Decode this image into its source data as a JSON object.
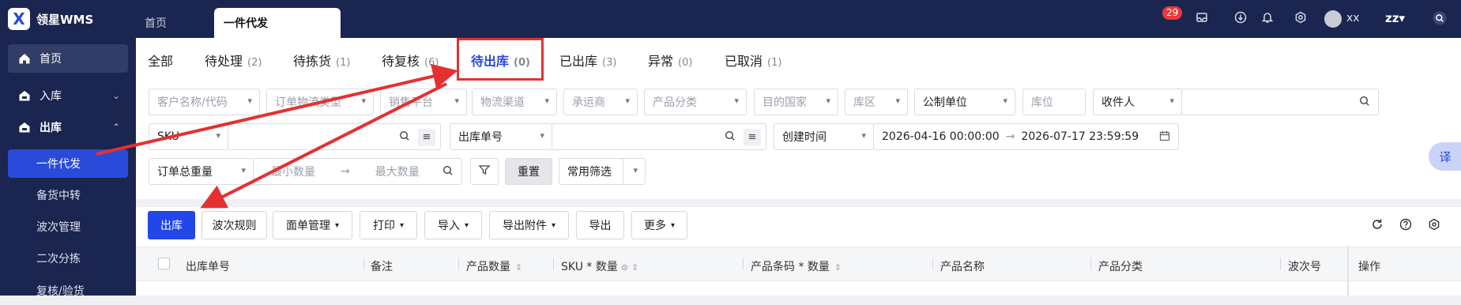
{
  "app": {
    "logo_letter": "X",
    "name": "领星WMS"
  },
  "top_tabs": [
    {
      "label": "首页"
    },
    {
      "label": "一件代发"
    }
  ],
  "header": {
    "notification_count": "29",
    "user_name": "xx",
    "org": "zz▾"
  },
  "sidebar": {
    "items": [
      {
        "label": "首页"
      },
      {
        "label": "入库"
      },
      {
        "label": "出库"
      },
      {
        "label": "一件代发"
      },
      {
        "label": "备货中转"
      },
      {
        "label": "波次管理"
      },
      {
        "label": "二次分拣"
      },
      {
        "label": "复核/验货"
      }
    ]
  },
  "status_tabs": [
    {
      "label": "全部",
      "count": ""
    },
    {
      "label": "待处理",
      "count": "(2)"
    },
    {
      "label": "待拣货",
      "count": "(1)"
    },
    {
      "label": "待复核",
      "count": "(6)"
    },
    {
      "label": "待出库",
      "count": "(0)"
    },
    {
      "label": "已出库",
      "count": "(3)"
    },
    {
      "label": "异常",
      "count": "(0)"
    },
    {
      "label": "已取消",
      "count": "(1)"
    }
  ],
  "filters": {
    "customer": "客户名称/代码",
    "order_type": "订单物流类型",
    "platform": "销售平台",
    "channel": "物流渠道",
    "carrier": "承运商",
    "category": "产品分类",
    "country": "目的国家",
    "zone": "库区",
    "unit": "公制单位",
    "location": "库位",
    "receiver": "收件人",
    "sku": "SKU",
    "order_no": "出库单号",
    "time_type": "创建时间",
    "date_start": "2026-04-16 00:00:00",
    "date_end": "2026-07-17 23:59:59",
    "weight": "订单总重量",
    "min_qty": "最小数量",
    "max_qty": "最大数量",
    "reset": "重置",
    "common": "常用筛选"
  },
  "toolbar": {
    "ship": "出库",
    "wave_rule": "波次规则",
    "waybill": "面单管理",
    "print": "打印",
    "import": "导入",
    "export_attach": "导出附件",
    "export": "导出",
    "more": "更多"
  },
  "table": {
    "headers": [
      "出库单号",
      "备注",
      "产品数量",
      "SKU * 数量",
      "产品条码 * 数量",
      "产品名称",
      "产品分类",
      "波次号",
      "操作"
    ]
  },
  "translate_btn": "译",
  "colors": {
    "nav_bg": "#1a2550",
    "accent": "#2346e8",
    "highlight": "#e53030",
    "badge": "#e83a3a"
  }
}
